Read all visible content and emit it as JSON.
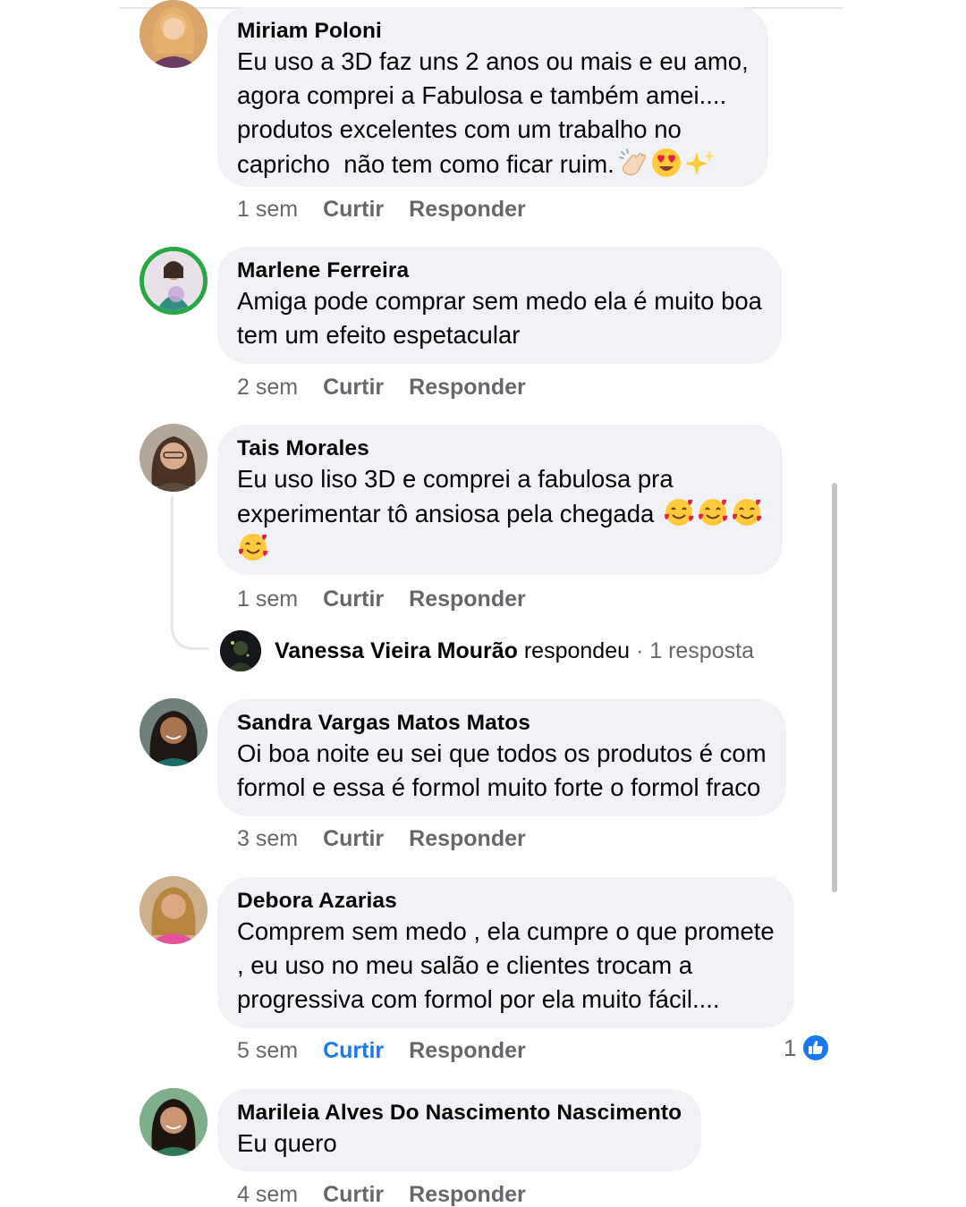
{
  "actions": {
    "like_label": "Curtir",
    "reply_label": "Responder"
  },
  "comments": [
    {
      "author": "Miriam Poloni",
      "lines": [
        "Eu uso a 3D faz uns 2 anos ou mais e eu amo,",
        "agora comprei a Fabulosa e também amei....",
        "produtos excelentes com um trabalho no",
        "capricho  não tem como ficar ruim."
      ],
      "emojis": [
        "clapping-hands",
        "heart-eyes",
        "sparkles"
      ],
      "time": "1 sem"
    },
    {
      "author": "Marlene Ferreira",
      "lines": [
        "Amiga pode comprar sem medo ela é muito boa",
        "tem um efeito espetacular"
      ],
      "time": "2 sem"
    },
    {
      "author": "Tais Morales",
      "lines": [
        "Eu uso liso 3D e comprei a fabulosa pra",
        "experimentar tô ansiosa pela chegada"
      ],
      "emojis": [
        "smiling-face-with-hearts",
        "smiling-face-with-hearts",
        "smiling-face-with-hearts",
        "smiling-face-with-hearts"
      ],
      "time": "1 sem",
      "reply": {
        "name": "Vanessa Vieira Mourão",
        "action": "respondeu",
        "meta": " · 1 resposta"
      }
    },
    {
      "author": "Sandra Vargas Matos Matos",
      "lines": [
        "Oi boa noite eu sei que todos os produtos é com",
        "formol e essa é formol muito forte o formol fraco"
      ],
      "time": "3 sem"
    },
    {
      "author": "Debora Azarias",
      "lines": [
        "Comprem sem medo , ela cumpre o que promete",
        ", eu uso no meu salão e clientes trocam a",
        "progressiva com formol por ela muito fácil...."
      ],
      "time": "5 sem",
      "liked": true,
      "like_count": "1"
    },
    {
      "author": "Marileia Alves Do Nascimento Nascimento",
      "lines": [
        "Eu quero"
      ],
      "time": "4 sem"
    }
  ],
  "colors": {
    "bubble": "#f0f2f5",
    "meta_text": "#65676b",
    "accent_blue": "#1877f2",
    "avatar_ring": "#27a844"
  },
  "icons": {
    "like": "thumbs-up-icon"
  }
}
